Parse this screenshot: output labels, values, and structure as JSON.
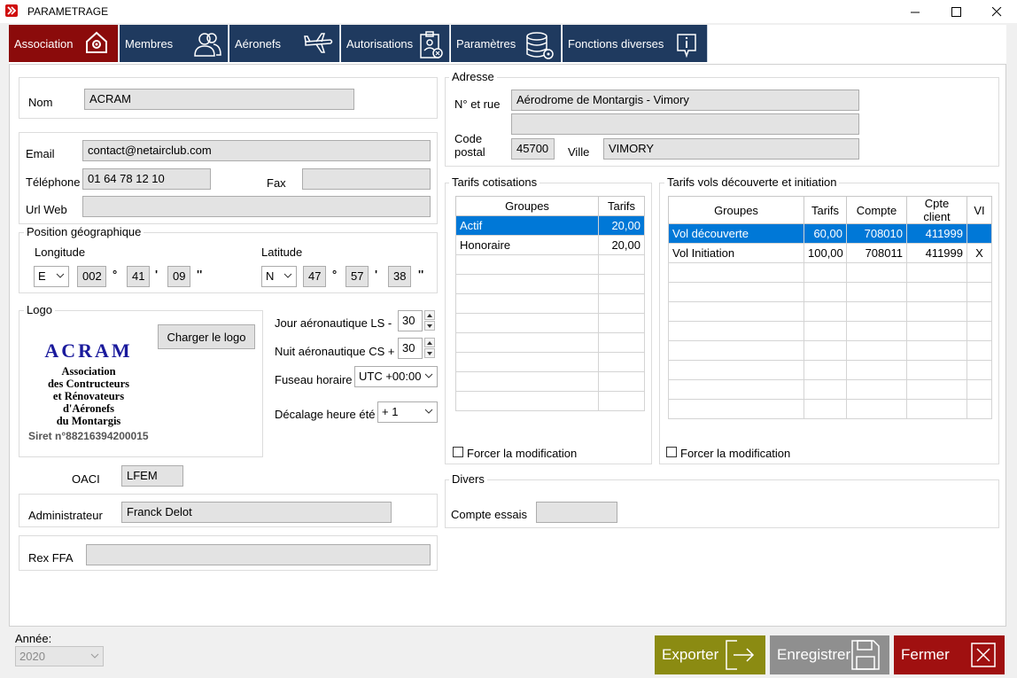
{
  "window": {
    "title": "PARAMETRAGE",
    "minimize_icon": "minimize-icon",
    "maximize_icon": "maximize-icon",
    "close_icon": "close-icon"
  },
  "tabs": [
    {
      "label": "Association",
      "icon": "house-gear-icon",
      "active": true
    },
    {
      "label": "Membres",
      "icon": "users-icon"
    },
    {
      "label": "Aéronefs",
      "icon": "airplane-icon"
    },
    {
      "label": "Autorisations",
      "icon": "badge-icon"
    },
    {
      "label": "Paramètres",
      "icon": "database-gear-icon"
    },
    {
      "label": "Fonctions diverses",
      "icon": "info-icon"
    }
  ],
  "association": {
    "nom_label": "Nom",
    "nom": "ACRAM",
    "email_label": "Email",
    "email": "contact@netairclub.com",
    "tel_label": "Téléphone",
    "tel": "01 64 78 12 10",
    "fax_label": "Fax",
    "fax": "",
    "url_label": "Url Web",
    "url": ""
  },
  "position": {
    "title": "Position géographique",
    "longitude_label": "Longitude",
    "lon_dir": "E",
    "lon_deg": "002",
    "lon_min": "41",
    "lon_sec": "09",
    "latitude_label": "Latitude",
    "lat_dir": "N",
    "lat_deg": "47",
    "lat_min": "57",
    "lat_sec": "38",
    "deg_sym": "°",
    "min_sym": "'",
    "sec_sym": "''"
  },
  "logo": {
    "title": "Logo",
    "load_button": "Charger le logo",
    "name": "ACRAM",
    "lines": [
      "Association",
      "des Contructeurs",
      "et Rénovateurs",
      "d'Aéronefs",
      "du Montargis"
    ],
    "siret": "Siret n°88216394200015"
  },
  "aero": {
    "jour_label": "Jour aéronautique LS -",
    "jour": "30",
    "nuit_label": "Nuit aéronautique CS +",
    "nuit": "30",
    "fuseau_label": "Fuseau horaire",
    "fuseau": "UTC +00:00",
    "decalage_label": "Décalage heure été",
    "decalage": "+ 1"
  },
  "oaci": {
    "label": "OACI",
    "value": "LFEM"
  },
  "admin": {
    "label": "Administrateur",
    "value": "Franck Delot"
  },
  "rex": {
    "label": "Rex FFA",
    "value": ""
  },
  "adresse": {
    "title": "Adresse",
    "rue_label": "N° et rue",
    "rue": "Aérodrome de Montargis - Vimory",
    "rue2": "",
    "cp_label_1": "Code",
    "cp_label_2": "postal",
    "cp": "45700",
    "ville_label": "Ville",
    "ville": "VIMORY"
  },
  "cotisations": {
    "title": "Tarifs cotisations",
    "headers": [
      "Groupes",
      "Tarifs"
    ],
    "rows": [
      [
        "Actif",
        "20,00"
      ],
      [
        "Honoraire",
        "20,00"
      ]
    ],
    "force_label": "Forcer la modification"
  },
  "decouverte": {
    "title": "Tarifs vols découverte et initiation",
    "headers": [
      "Groupes",
      "Tarifs",
      "Compte",
      "Cpte client",
      "VI"
    ],
    "rows": [
      [
        "Vol découverte",
        "60,00",
        "708010",
        "411999",
        ""
      ],
      [
        "Vol Initiation",
        "100,00",
        "708011",
        "411999",
        "X"
      ]
    ],
    "force_label": "Forcer la modification"
  },
  "divers": {
    "title": "Divers",
    "compte_label": "Compte essais",
    "compte": ""
  },
  "footer": {
    "annee_label": "Année:",
    "annee": "2020",
    "exporter": "Exporter",
    "enregistrer": "Enregistrer",
    "fermer": "Fermer",
    "exporter_color": "#8b8b12",
    "enregistrer_color": "#8f8f8f",
    "fermer_color": "#a01010"
  }
}
